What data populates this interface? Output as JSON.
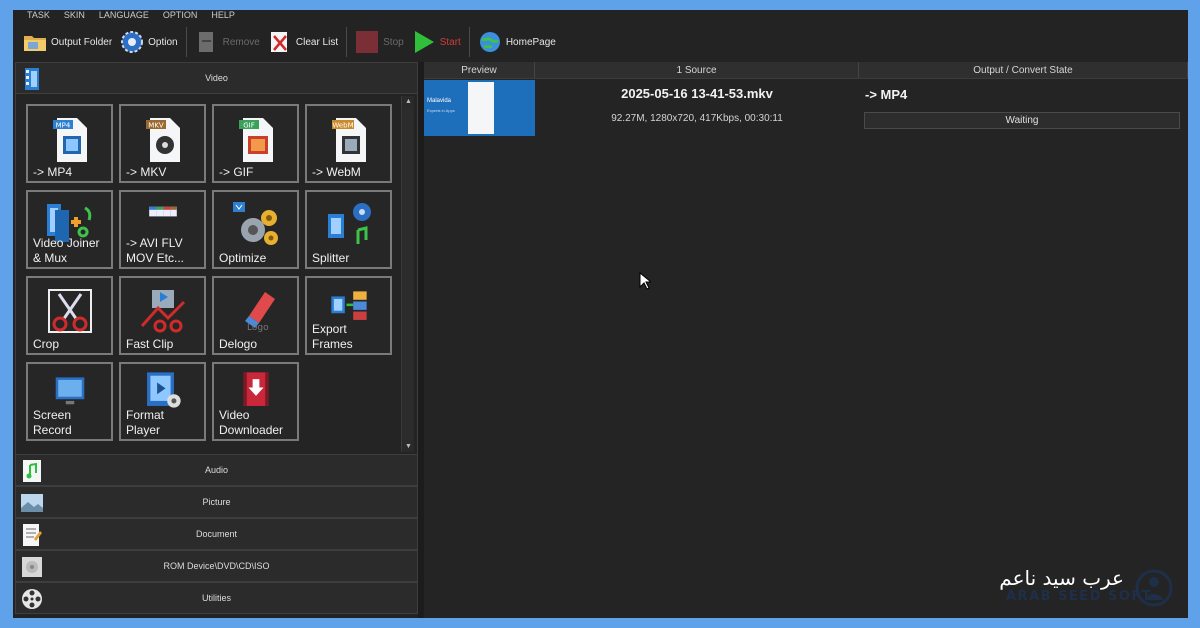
{
  "menu": [
    "TASK",
    "SKIN",
    "LANGUAGE",
    "OPTION",
    "HELP"
  ],
  "toolbar": {
    "output_folder": "Output Folder",
    "option": "Option",
    "remove": "Remove",
    "clear_list": "Clear List",
    "stop": "Stop",
    "start": "Start",
    "homepage": "HomePage"
  },
  "categories": {
    "video": "Video",
    "audio": "Audio",
    "picture": "Picture",
    "document": "Document",
    "rom": "ROM Device\\DVD\\CD\\ISO",
    "utilities": "Utilities"
  },
  "tiles": [
    {
      "label": "-> MP4",
      "badge": "MP4",
      "icon": "mp4-file-icon"
    },
    {
      "label": "-> MKV",
      "badge": "MKV",
      "icon": "mkv-file-icon"
    },
    {
      "label": "-> GIF",
      "badge": "GIF",
      "icon": "gif-file-icon"
    },
    {
      "label": "-> WebM",
      "badge": "WebM",
      "icon": "webm-file-icon"
    },
    {
      "label": "Video Joiner & Mux",
      "icon": "video-joiner-icon"
    },
    {
      "label": "-> AVI FLV\nMOV Etc...",
      "icon": "multi-format-icon"
    },
    {
      "label": "Optimize",
      "icon": "optimize-gears-icon"
    },
    {
      "label": "Splitter",
      "icon": "splitter-icon"
    },
    {
      "label": "Crop",
      "icon": "crop-scissors-icon"
    },
    {
      "label": "Fast Clip",
      "icon": "fast-clip-icon"
    },
    {
      "label": "Delogo",
      "icon": "delogo-eraser-icon"
    },
    {
      "label": "Export\nFrames",
      "icon": "export-frames-icon"
    },
    {
      "label": "Screen\nRecord",
      "icon": "screen-record-icon"
    },
    {
      "label": "Format\nPlayer",
      "icon": "format-player-icon"
    },
    {
      "label": "Video\nDownloader",
      "icon": "video-downloader-icon"
    }
  ],
  "columns": {
    "preview": "Preview",
    "source": "1 Source",
    "output": "Output / Convert State"
  },
  "file": {
    "name": "2025-05-16 13-41-53.mkv",
    "meta": "92.27M, 1280x720, 417Kbps, 00:30:11",
    "target": "-> MP4",
    "state": "Waiting",
    "thumb_logo": "Malavida",
    "thumb_sub": "Experts in Apps"
  },
  "watermark": {
    "arabic": "عرب سيد ناعم",
    "latin": "ARAB SEED SOFT"
  }
}
